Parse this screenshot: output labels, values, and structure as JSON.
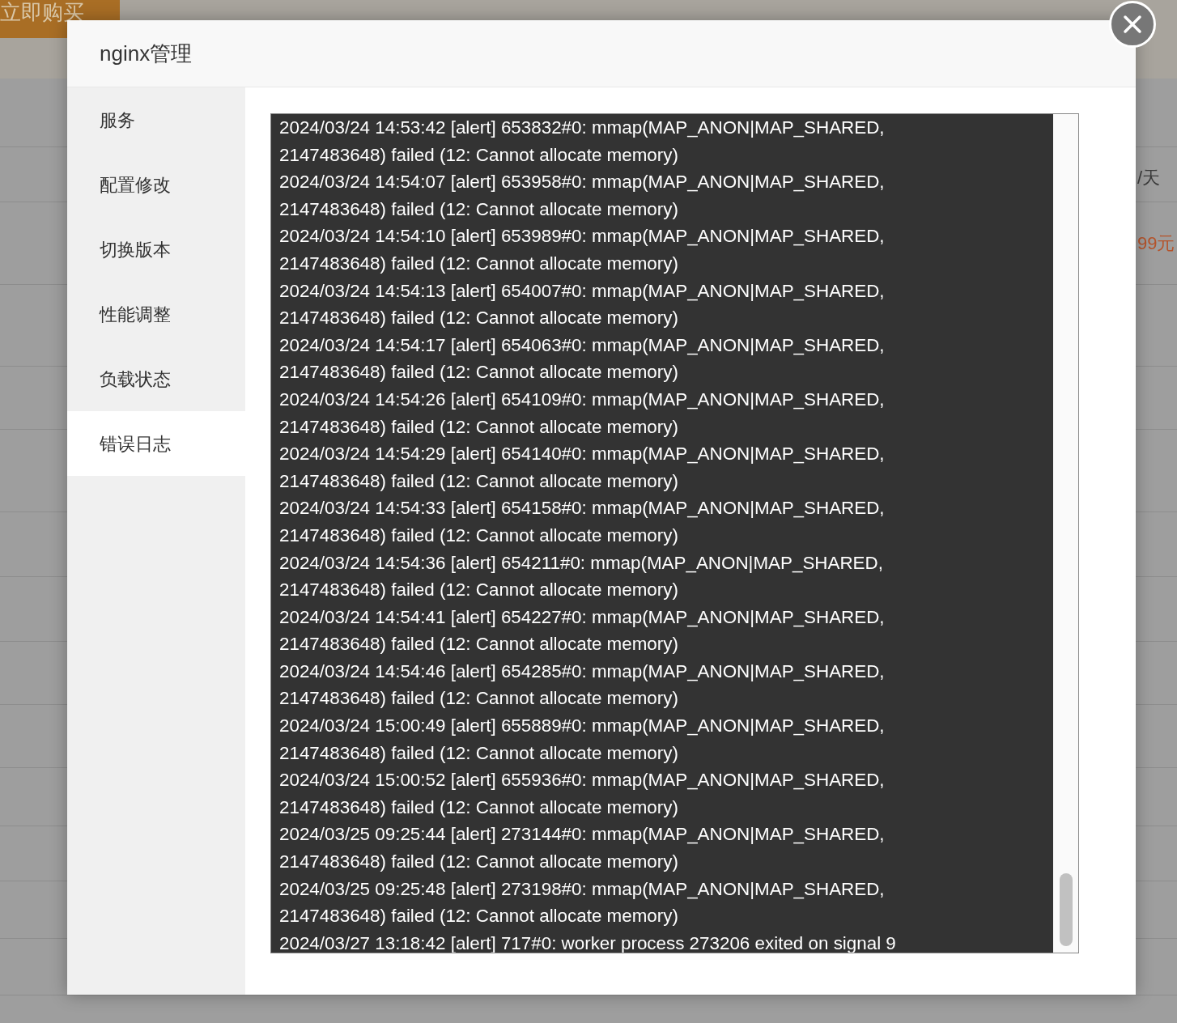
{
  "background": {
    "buy_button": "立即购买",
    "price_unit": "/天",
    "price": "99元"
  },
  "dialog": {
    "title": "nginx管理",
    "menu": [
      {
        "label": "服务",
        "selected": false
      },
      {
        "label": "配置修改",
        "selected": false
      },
      {
        "label": "切换版本",
        "selected": false
      },
      {
        "label": "性能调整",
        "selected": false
      },
      {
        "label": "负载状态",
        "selected": false
      },
      {
        "label": "错误日志",
        "selected": true
      }
    ],
    "log_lines": [
      "2024/03/24 14:53:42 [alert] 653832#0: mmap(MAP_ANON|MAP_SHARED,",
      "2147483648) failed (12: Cannot allocate memory)",
      "2024/03/24 14:54:07 [alert] 653958#0: mmap(MAP_ANON|MAP_SHARED,",
      "2147483648) failed (12: Cannot allocate memory)",
      "2024/03/24 14:54:10 [alert] 653989#0: mmap(MAP_ANON|MAP_SHARED,",
      "2147483648) failed (12: Cannot allocate memory)",
      "2024/03/24 14:54:13 [alert] 654007#0: mmap(MAP_ANON|MAP_SHARED,",
      "2147483648) failed (12: Cannot allocate memory)",
      "2024/03/24 14:54:17 [alert] 654063#0: mmap(MAP_ANON|MAP_SHARED,",
      "2147483648) failed (12: Cannot allocate memory)",
      "2024/03/24 14:54:26 [alert] 654109#0: mmap(MAP_ANON|MAP_SHARED,",
      "2147483648) failed (12: Cannot allocate memory)",
      "2024/03/24 14:54:29 [alert] 654140#0: mmap(MAP_ANON|MAP_SHARED,",
      "2147483648) failed (12: Cannot allocate memory)",
      "2024/03/24 14:54:33 [alert] 654158#0: mmap(MAP_ANON|MAP_SHARED,",
      "2147483648) failed (12: Cannot allocate memory)",
      "2024/03/24 14:54:36 [alert] 654211#0: mmap(MAP_ANON|MAP_SHARED,",
      "2147483648) failed (12: Cannot allocate memory)",
      "2024/03/24 14:54:41 [alert] 654227#0: mmap(MAP_ANON|MAP_SHARED,",
      "2147483648) failed (12: Cannot allocate memory)",
      "2024/03/24 14:54:46 [alert] 654285#0: mmap(MAP_ANON|MAP_SHARED,",
      "2147483648) failed (12: Cannot allocate memory)",
      "2024/03/24 15:00:49 [alert] 655889#0: mmap(MAP_ANON|MAP_SHARED,",
      "2147483648) failed (12: Cannot allocate memory)",
      "2024/03/24 15:00:52 [alert] 655936#0: mmap(MAP_ANON|MAP_SHARED,",
      "2147483648) failed (12: Cannot allocate memory)",
      "2024/03/25 09:25:44 [alert] 273144#0: mmap(MAP_ANON|MAP_SHARED,",
      "2147483648) failed (12: Cannot allocate memory)",
      "2024/03/25 09:25:48 [alert] 273198#0: mmap(MAP_ANON|MAP_SHARED,",
      "2147483648) failed (12: Cannot allocate memory)",
      "2024/03/27 13:18:42 [alert] 717#0: worker process 273206 exited on signal 9"
    ]
  }
}
